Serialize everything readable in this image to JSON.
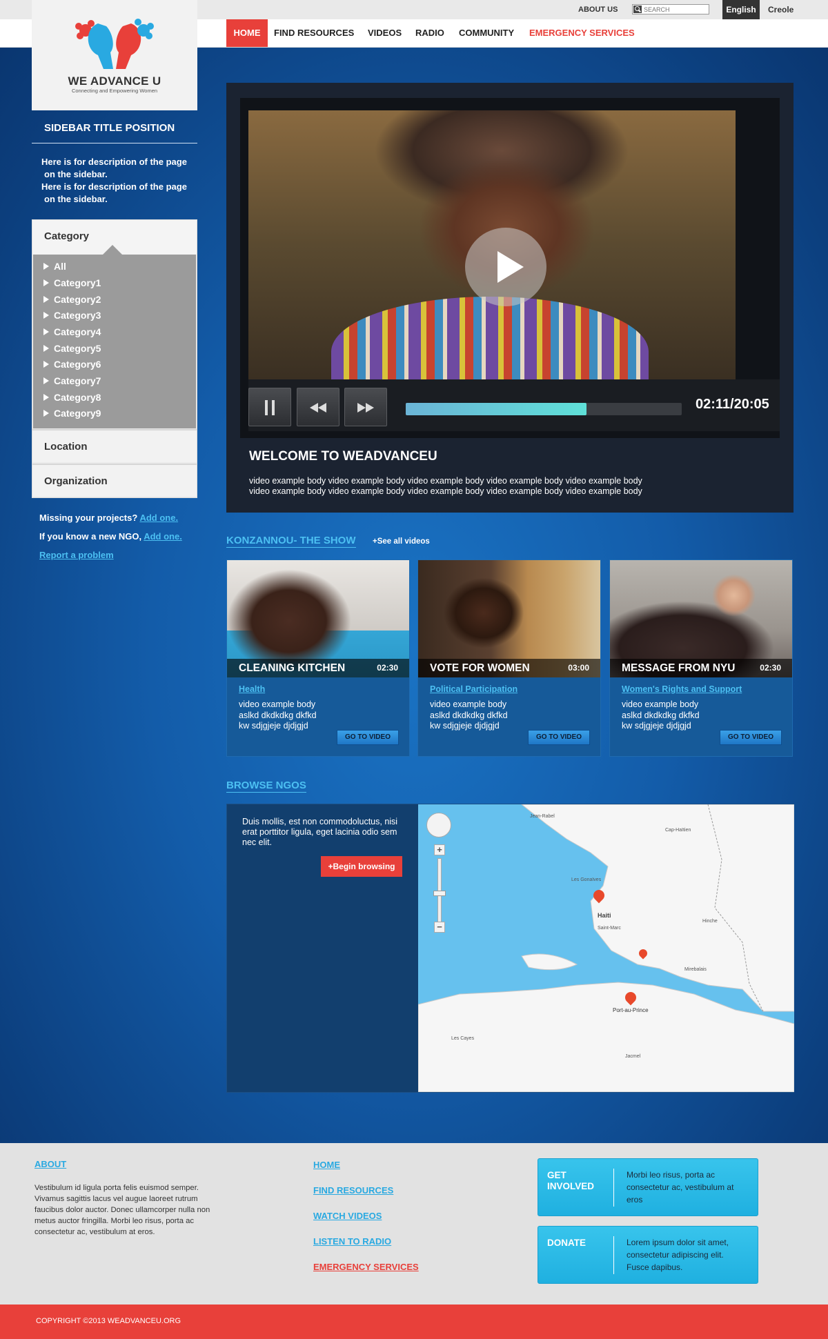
{
  "topbar": {
    "about_us": "ABOUT US",
    "search_placeholder": "SEARCH",
    "lang_english": "English",
    "lang_creole": "Creole"
  },
  "nav": {
    "home": "HOME",
    "find_resources": "FIND RESOURCES",
    "videos": "VIDEOS",
    "radio": "RADIO",
    "community": "COMMUNITY",
    "emergency": "EMERGENCY SERVICES"
  },
  "logo": {
    "title": "WE ADVANCE U",
    "subtitle": "Connecting and Empowering Women"
  },
  "sidebar": {
    "title": "SIDEBAR TITLE POSITION",
    "desc1": "Here is for description of the page",
    "desc2": "on the sidebar.",
    "desc3": "Here is for description of the page",
    "desc4": "on the sidebar.",
    "category_label": "Category",
    "categories": [
      "All",
      "Category1",
      "Category2",
      "Category3",
      "Category4",
      "Category5",
      "Category6",
      "Category7",
      "Category8",
      "Category9"
    ],
    "location_label": "Location",
    "organization_label": "Organization",
    "missing_text": "Missing your projects?",
    "add_one_1": "Add one.",
    "new_ngo_text": "If you know a new NGO,",
    "add_one_2": "Add one.",
    "report": "Report a problem"
  },
  "player": {
    "time": "02:11/20:05",
    "progress": 0.655,
    "welcome_title": "WELCOME TO WEADVANCEU",
    "welcome_body_1": "video example body video example body video example body video example body video example body",
    "welcome_body_2": "video example body video example body video example body video example body video example body"
  },
  "show": {
    "title": "KONZANNOU- THE SHOW",
    "see_all": "+See all videos",
    "go_label": "GO TO VIDEO",
    "cards": [
      {
        "title": "CLEANING KITCHEN",
        "time": "02:30",
        "category": "Health",
        "body1": "video example body",
        "body2": "aslkd dkdkdkg dkfkd",
        "body3": "kw sdjgjeje djdjgjd"
      },
      {
        "title": "VOTE FOR WOMEN",
        "time": "03:00",
        "category": "Political Participation",
        "body1": "video example body",
        "body2": "aslkd dkdkdkg dkfkd",
        "body3": "kw sdjgjeje djdjgjd"
      },
      {
        "title": "MESSAGE FROM NYU",
        "time": "02:30",
        "category": "Women's Rights and Support",
        "body1": "video example body",
        "body2": "aslkd dkdkdkg dkfkd",
        "body3": "kw sdjgjeje djdjgjd"
      }
    ]
  },
  "browse": {
    "title": "BROWSE NGOS",
    "text": "Duis mollis, est non commodoluctus, nisi erat porttitor ligula, eget lacinia odio sem nec elit.",
    "button": "+Begin browsing",
    "map_labels": {
      "haiti": "Haiti",
      "port_au_prince": "Port-au-Prince",
      "cap_haitien": "Cap-Haïtien",
      "hinche": "Hinche",
      "gonaives": "Les Gonaïves",
      "saint_marc": "Saint-Marc",
      "jacmel": "Jacmel",
      "les_cayes": "Les Cayes",
      "mirebalais": "Mirebalais",
      "jean_rabel": "Jean-Rabel"
    }
  },
  "footer": {
    "about_title": "ABOUT",
    "about_text": "Vestibulum id ligula porta felis euismod semper. Vivamus sagittis lacus vel augue laoreet rutrum faucibus dolor auctor. Donec ullamcorper nulla non metus auctor fringilla. Morbi leo risus, porta ac consectetur ac, vestibulum at eros.",
    "links": [
      "HOME",
      "FIND RESOURCES",
      "WATCH VIDEOS",
      "LISTEN TO RADIO",
      "EMERGENCY SERVICES"
    ],
    "get_involved_title": "GET INVOLVED",
    "get_involved_text": "Morbi leo risus, porta ac consectetur ac, vestibulum at eros",
    "donate_title": "DONATE",
    "donate_text": "Lorem ipsum dolor sit amet, consectetur adipiscing elit. Fusce dapibus.",
    "copyright": "COPYRIGHT ©2013 WEADVANCEU.ORG"
  },
  "colors": {
    "accent_red": "#e8403a",
    "link_blue": "#4cc0f2",
    "bg_blue": "#135ca9"
  }
}
